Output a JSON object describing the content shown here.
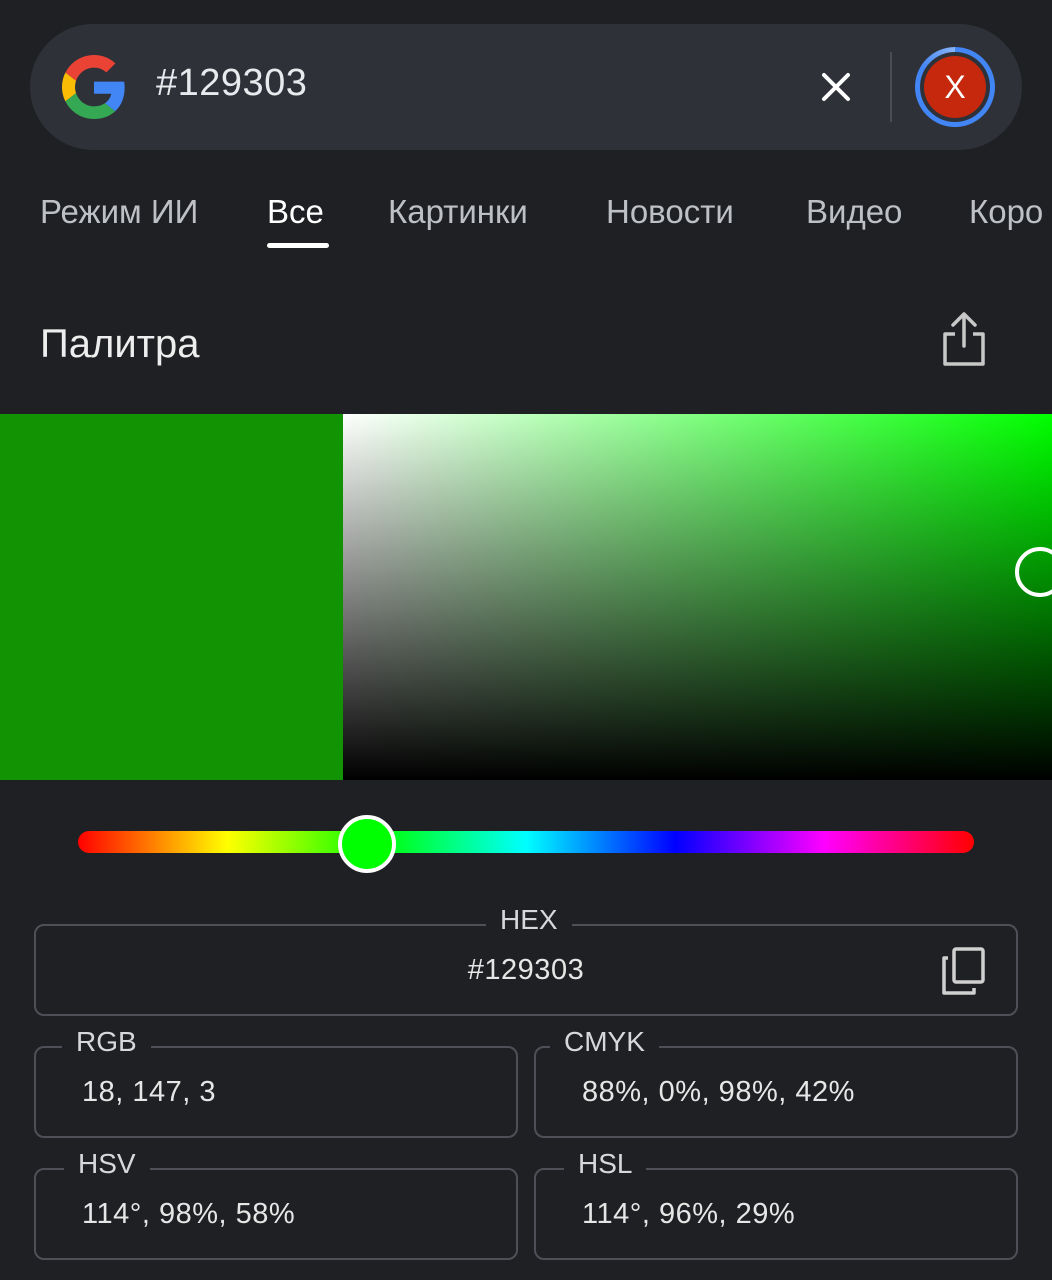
{
  "search": {
    "query": "#129303",
    "clear_label": "✕",
    "avatar_letter": "X",
    "avatar_color": "#c5280d"
  },
  "tabs": [
    {
      "label": "Режим ИИ"
    },
    {
      "label": "Все",
      "active": true
    },
    {
      "label": "Картинки"
    },
    {
      "label": "Новости"
    },
    {
      "label": "Видео"
    },
    {
      "label": "Коро"
    }
  ],
  "palette": {
    "title": "Палитра",
    "selected_color": "#129303",
    "hue_color": "#00ff00",
    "hue_degrees": 114,
    "saturation_fraction": 0.98,
    "value_fraction": 0.58
  },
  "fields": {
    "hex": {
      "label": "HEX",
      "value": "#129303"
    },
    "rgb": {
      "label": "RGB",
      "value": "18, 147, 3"
    },
    "cmyk": {
      "label": "CMYK",
      "value": "88%, 0%, 98%, 42%"
    },
    "hsv": {
      "label": "HSV",
      "value": "114°, 98%, 58%"
    },
    "hsl": {
      "label": "HSL",
      "value": "114°, 96%, 29%"
    }
  }
}
